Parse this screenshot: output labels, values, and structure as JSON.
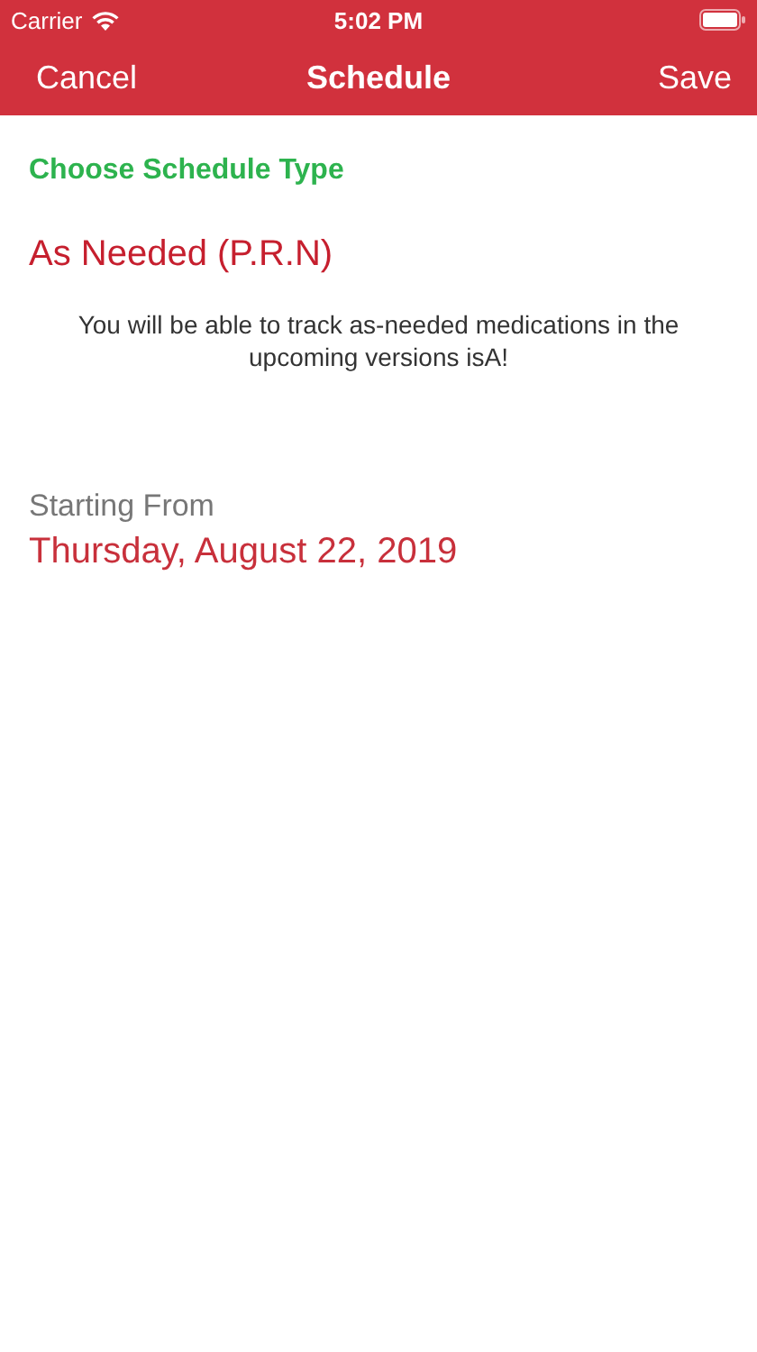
{
  "status_bar": {
    "carrier": "Carrier",
    "time": "5:02 PM"
  },
  "nav_bar": {
    "left": "Cancel",
    "title": "Schedule",
    "right": "Save"
  },
  "section_title": "Choose Schedule Type",
  "schedule_type": "As Needed (P.R.N)",
  "note": "You will be able to track as-needed medications in the upcoming versions isA!",
  "start": {
    "label": "Starting From",
    "date": "Thursday, August 22, 2019"
  }
}
